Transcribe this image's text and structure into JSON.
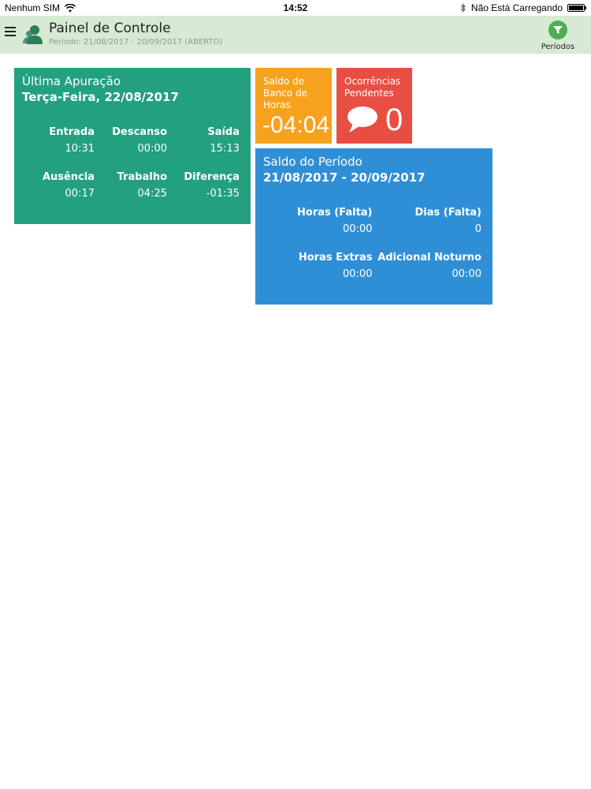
{
  "status_bar": {
    "carrier": "Nenhum SIM",
    "time": "14:52",
    "charging_status": "Não Está Carregando",
    "icons": [
      "wifi-icon",
      "bluetooth-icon",
      "battery-icon"
    ]
  },
  "header": {
    "title": "Painel de Controle",
    "subtitle": "Período: 21/08/2017 - 20/09/2017 (ABERTO)",
    "periods_button_label": "Períodos",
    "icons": [
      "hamburger-menu-icon",
      "user-avatar-icon",
      "filter-icon"
    ]
  },
  "last_tally": {
    "heading": "Última Apuração",
    "date": "Terça-Feira, 22/08/2017",
    "row1": [
      {
        "label": "Entrada",
        "value": "10:31"
      },
      {
        "label": "Descanso",
        "value": "00:00"
      },
      {
        "label": "Saída",
        "value": "15:13"
      }
    ],
    "row2": [
      {
        "label": "Ausência",
        "value": "00:17"
      },
      {
        "label": "Trabalho",
        "value": "04:25"
      },
      {
        "label": "Diferença",
        "value": "-01:35"
      }
    ]
  },
  "hour_bank": {
    "heading_line1": "Saldo de",
    "heading_line2": "Banco de",
    "heading_line3": "Horas",
    "value": "-04:04"
  },
  "pending": {
    "heading_line1": "Ocorrências",
    "heading_line2": "Pendentes",
    "count": "0",
    "icon": "speech-bubble-icon"
  },
  "period_balance": {
    "heading": "Saldo do Período",
    "range": "21/08/2017 - 20/09/2017",
    "row1": [
      {
        "label": "Horas (Falta)",
        "value": "00:00"
      },
      {
        "label": "Dias (Falta)",
        "value": "0"
      }
    ],
    "row2": [
      {
        "label": "Horas Extras",
        "value": "00:00"
      },
      {
        "label": "Adicional Noturno",
        "value": "00:00"
      }
    ]
  },
  "colors": {
    "header_bg": "#d7ead3",
    "green_tile": "#22a07f",
    "orange_tile": "#f6a21e",
    "red_tile": "#e94e42",
    "blue_tile": "#2f8fd6",
    "filter_button": "#4caf50"
  }
}
